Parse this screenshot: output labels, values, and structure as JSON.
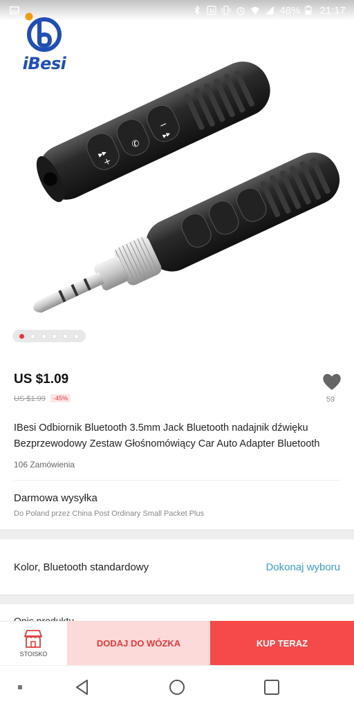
{
  "status_bar": {
    "battery": "48%",
    "time": "21:17"
  },
  "logo": {
    "text": "iBesi"
  },
  "app_bar": {
    "icons": [
      "back-arrow-icon",
      "search-icon",
      "cart-icon",
      "share-icon",
      "more-vert-icon"
    ]
  },
  "gallery": {
    "image_count": 6,
    "active_index": 0
  },
  "product": {
    "price": "US $1.09",
    "old_price": "US $1.99",
    "discount": "-45%",
    "wishlist_count": "59",
    "title": "IBesi Odbiornik Bluetooth 3.5mm Jack Bluetooth nadajnik dźwięku Bezprzewodowy Zestaw Głośnomówiący Car Auto Adapter Bluetooth",
    "orders": "106 Zamówienia"
  },
  "shipping": {
    "title": "Darmowa wysyłka",
    "subtitle": "Do Poland przez China Post Ordinary Small Packet Plus"
  },
  "variant": {
    "label": "Kolor, Bluetooth standardowy",
    "action": "Dokonaj wyboru"
  },
  "description_peek": "Opis produktu",
  "action_bar": {
    "store_label": "STOISKO",
    "add_to_cart": "DODAJ DO WÓZKA",
    "buy_now": "KUP TERAZ"
  },
  "colors": {
    "accent_red": "#f44a4a",
    "light_red": "#fddada",
    "link_blue": "#3a9fc5",
    "logo_blue": "#1f4fb5",
    "logo_orange": "#f39c12"
  }
}
